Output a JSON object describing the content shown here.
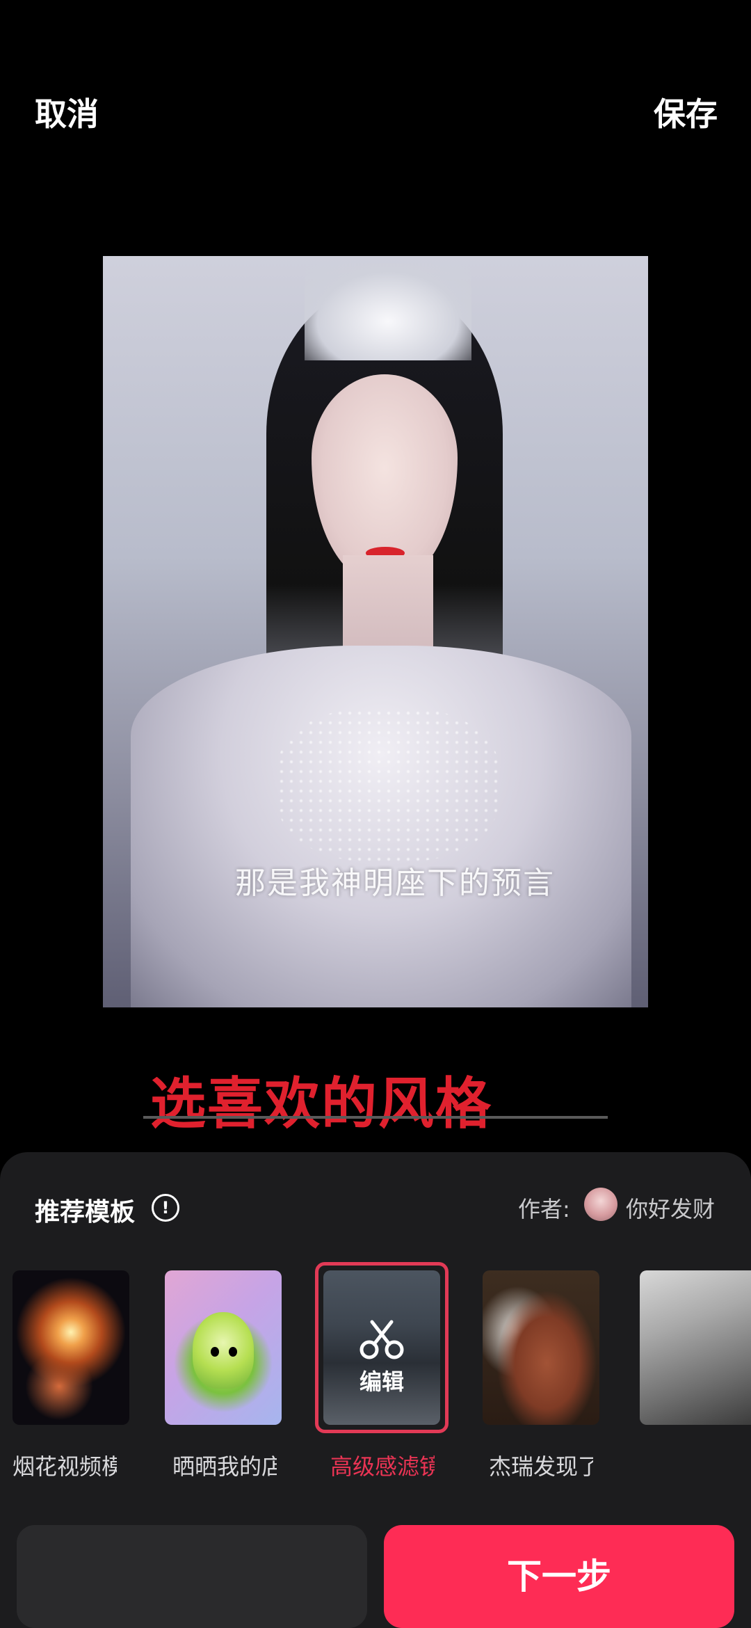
{
  "topbar": {
    "cancel_label": "取消",
    "save_label": "保存"
  },
  "preview": {
    "subtitle": "那是我神明座下的预言"
  },
  "hint": {
    "text": "选喜欢的风格"
  },
  "sheet": {
    "title": "推荐模板",
    "info_icon": "!",
    "author_label": "作者:",
    "author_name": "你好发财",
    "templates": [
      {
        "label": "烟花视频模"
      },
      {
        "label": "晒晒我的店"
      },
      {
        "label": "高级感滤镜",
        "overlay_label": "编辑",
        "selected": true
      },
      {
        "label": "杰瑞发现了"
      },
      {
        "label": ""
      }
    ]
  },
  "footer": {
    "next_label": "下一步"
  },
  "colors": {
    "accent": "#fe2c55",
    "hint_red": "#e0212e",
    "sheet_bg": "#1c1c1e"
  }
}
